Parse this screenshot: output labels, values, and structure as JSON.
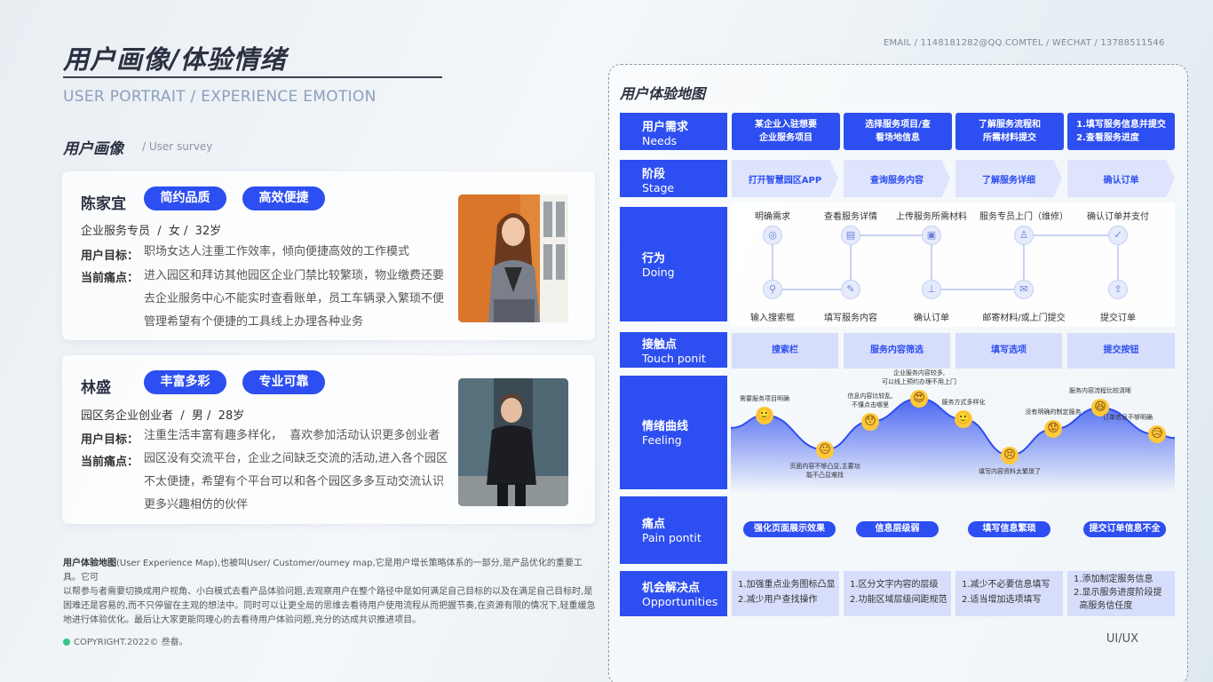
{
  "header": {
    "title": "用户画像/体验情绪",
    "subtitle": "USER PORTRAIT / EXPERIENCE EMOTION",
    "email": "EMAIL / 1148181282@QQ.COM",
    "tel": "TEL / WECHAT / 13788511546"
  },
  "section": {
    "title": "用户画像",
    "sub": "/ User survey"
  },
  "personas": [
    {
      "name": "陈家宜",
      "tags": [
        "简约品质",
        "高效便捷"
      ],
      "info": "企业服务专员  /  女 /  32岁",
      "goal_label": "用户目标：",
      "goal": "职场女达人注重工作效率，倾向便捷高效的工作模式",
      "pain_label": "当前痛点：",
      "pain_lines": [
        "进入园区和拜访其他园区企业门禁比较繁琐，物业缴费还要",
        "去企业服务中心不能实时查看账单，员工车辆录入繁琐不便",
        "管理希望有个便捷的工具线上办理各种业务"
      ]
    },
    {
      "name": "林盛",
      "tags": [
        "丰富多彩",
        "专业可靠"
      ],
      "info": "园区务企业创业者  /  男 /  28岁",
      "goal_label": "用户目标：",
      "goal": "注重生活丰富有趣多样化，  喜欢参加活动认识更多创业者",
      "pain_label": "当前痛点：",
      "pain_lines": [
        "园区没有交流平台，企业之间缺乏交流的活动,进入各个园区",
        "不太便捷，希望有个平台可以和各个园区多多互动交流认识",
        "更多兴趣相仿的伙伴"
      ]
    }
  ],
  "description": {
    "bold": "用户体验地图",
    "lines": [
      "(User Experience Map),也被叫User/ Customer/ourney map,它是用户增长策略体系的一部分,是产品优化的重要工具。它可",
      "以帮参与者需要切换成用户视角、小白模式去看产品体验问题,去观察用户在整个路径中是如何满足自己目标的以及在满足自己目标时,是",
      "困难还是容易的,而不只停留在主观的想法中。同时可以让更全局的思维去看待用户使用流程从而把握节奏,在资源有限的情况下,轻重缓急",
      "地进行体验优化。最后让大家更能同理心的去看待用户体验问题,充分的达成共识推进项目。"
    ]
  },
  "copyright": "COPYRIGHT.2022©  叁畚。",
  "uiux": "UI/UX",
  "map": {
    "title": "用户体验地图",
    "rows": [
      {
        "cn": "用户需求",
        "en": "Needs"
      },
      {
        "cn": "阶段",
        "en": "Stage"
      },
      {
        "cn": "行为",
        "en": "Doing"
      },
      {
        "cn": "接触点",
        "en": "Touch ponit"
      },
      {
        "cn": "情绪曲线",
        "en": "Feeling"
      },
      {
        "cn": "痛点",
        "en": "Pain pontit"
      },
      {
        "cn": "机会解决点",
        "en": "Opportunities"
      }
    ],
    "needs": [
      [
        "某企业入驻想要",
        "企业服务项目"
      ],
      [
        "选择服务项目/查",
        "看场地信息"
      ],
      [
        "了解服务流程和",
        "所需材料提交"
      ],
      [
        "1.填写服务信息并提交",
        "2.查看服务进度"
      ]
    ],
    "stages": [
      "打开智慧园区APP",
      "查询服务内容",
      "了解服务详细",
      "确认订单"
    ],
    "doing_top": [
      "明确需求",
      "查看服务详情",
      "上传服务所需材料",
      "服务专员上门（维修）",
      "确认订单并支付"
    ],
    "doing_bottom": [
      "输入搜索框",
      "填写服务内容",
      "确认订单",
      "邮寄材料/或上门提交",
      "提交订单"
    ],
    "touchpoints": [
      "搜索栏",
      "服务内容筛选",
      "填写选项",
      "提交按钮"
    ],
    "feelings": [
      {
        "lines": [
          "需要服务项目明确"
        ],
        "value": 0.7,
        "emoji": "🙂"
      },
      {
        "lines": [
          "页面内容不够凸显,主要功",
          "能不凸显难找"
        ],
        "value": 0.25,
        "emoji": "😐"
      },
      {
        "lines": [
          "信息内容比较乱,",
          "不懂点击哪里"
        ],
        "value": 0.62,
        "emoji": "😯"
      },
      {
        "lines": [
          "企业服务内容较多,",
          "可以线上预约办理不用上门"
        ],
        "value": 0.92,
        "emoji": "😍"
      },
      {
        "lines": [
          "服务方式多样化"
        ],
        "value": 0.65,
        "emoji": "🙂"
      },
      {
        "lines": [
          "填写内容资料太繁琐了"
        ],
        "value": 0.18,
        "emoji": "😣"
      },
      {
        "lines": [
          "没有明确的制定服务"
        ],
        "value": 0.52,
        "emoji": "😟"
      },
      {
        "lines": [
          "服务内容流程比较清晰"
        ],
        "value": 0.8,
        "emoji": "😆"
      },
      {
        "lines": [
          "订单信息不够明确"
        ],
        "value": 0.45,
        "emoji": "😥"
      }
    ],
    "pains": [
      "强化页面展示效果",
      "信息层级弱",
      "填写信息繁琐",
      "提交订单信息不全"
    ],
    "opportunities": [
      [
        "1.加强重点业务图标凸显",
        "2.减少用户查找操作"
      ],
      [
        "1.区分文字内容的层级",
        "2.功能区域层级间距规范"
      ],
      [
        "1.减少不必要信息填写",
        "2.适当增加选项填写"
      ],
      [
        "1.添加制定服务信息",
        "2.显示服务进度阶段提",
        "  高服务信任度"
      ]
    ]
  }
}
